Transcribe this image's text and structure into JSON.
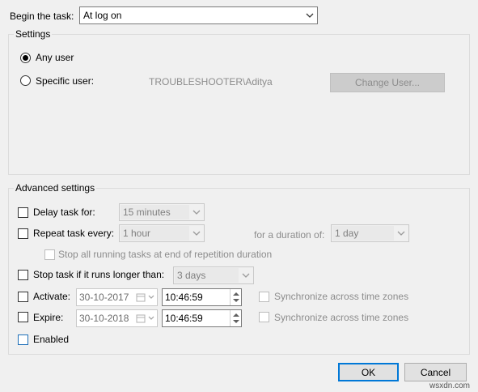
{
  "begin_task": {
    "label": "Begin the task:",
    "value": "At log on"
  },
  "settings": {
    "title": "Settings",
    "any_user": "Any user",
    "specific_user": "Specific user:",
    "user_value": "TROUBLESHOOTER\\Aditya",
    "change_user_button": "Change User..."
  },
  "advanced": {
    "title": "Advanced settings",
    "delay_label": "Delay task for:",
    "delay_value": "15 minutes",
    "repeat_label": "Repeat task every:",
    "repeat_value": "1 hour",
    "duration_label": "for a duration of:",
    "duration_value": "1 day",
    "stop_running_label": "Stop all running tasks at end of repetition duration",
    "stop_longer_label": "Stop task if it runs longer than:",
    "stop_longer_value": "3 days",
    "activate_label": "Activate:",
    "activate_date": "30-10-2017",
    "activate_time": "10:46:59",
    "expire_label": "Expire:",
    "expire_date": "30-10-2018",
    "expire_time": "10:46:59",
    "sync_label": "Synchronize across time zones",
    "enabled_label": "Enabled"
  },
  "buttons": {
    "ok": "OK",
    "cancel": "Cancel"
  },
  "watermark": "wsxdn.com"
}
